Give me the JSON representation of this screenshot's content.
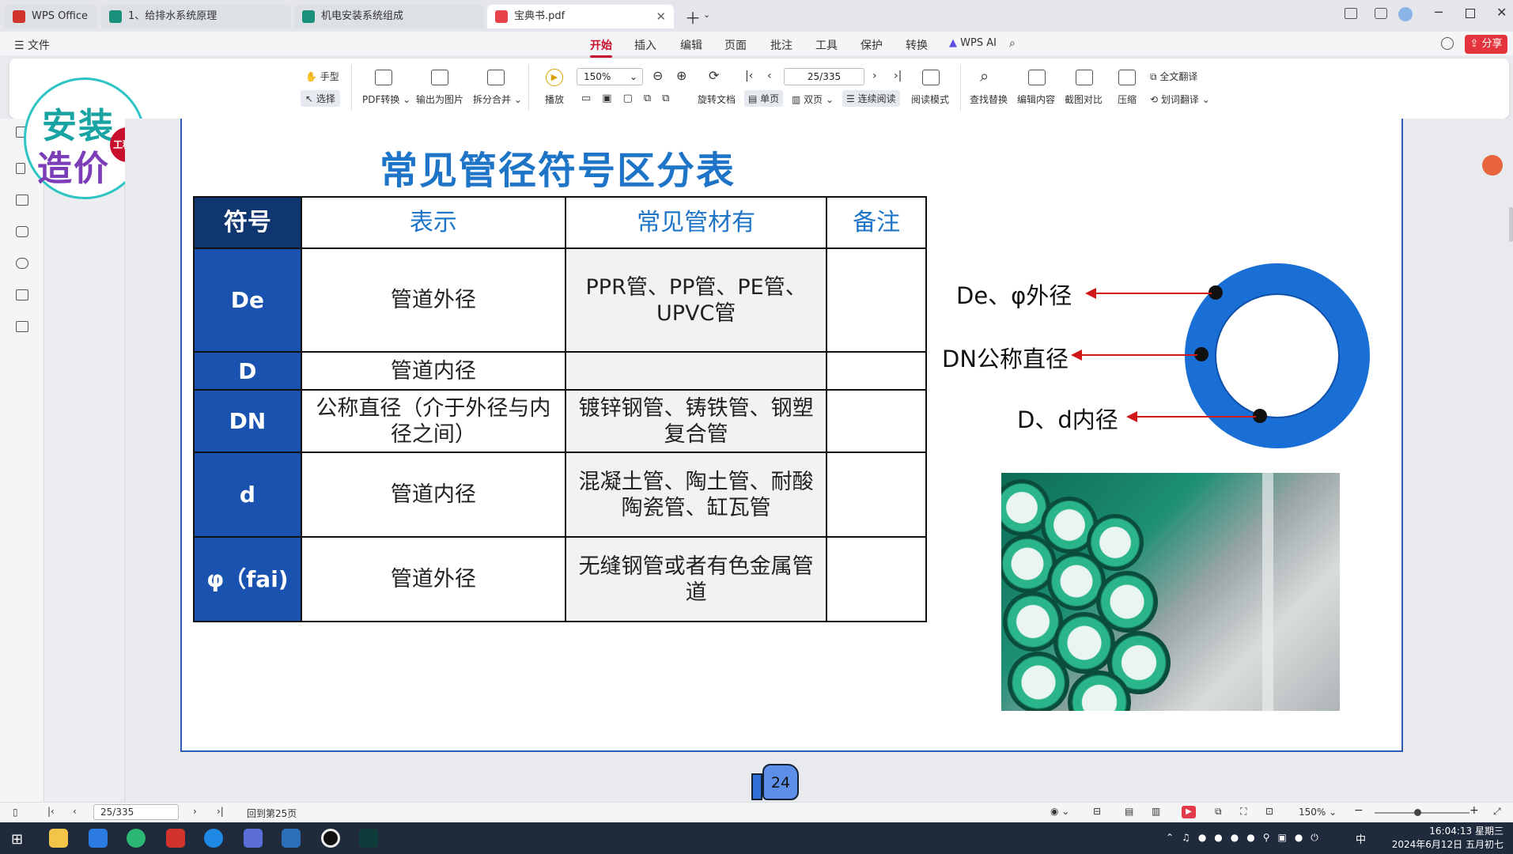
{
  "tabs": [
    {
      "label": "WPS Office",
      "icon": "wps-logo-icon"
    },
    {
      "label": "1、给排水系统原理",
      "icon": "document-icon"
    },
    {
      "label": "机电安装系统组成",
      "icon": "document-icon"
    },
    {
      "label": "宝典书.pdf",
      "icon": "pdf-icon"
    }
  ],
  "menubar": {
    "file": "文件",
    "items": [
      "开始",
      "插入",
      "编辑",
      "页面",
      "批注",
      "工具",
      "保护",
      "转换"
    ],
    "wps_ai": "WPS AI",
    "share": "分享"
  },
  "ribbon": {
    "hand": "手型",
    "select": "选择",
    "pdf_convert": "PDF转换",
    "export_image": "输出为图片",
    "split_merge": "拆分合并",
    "play": "播放",
    "zoom": "150%",
    "page": "25/335",
    "rotate": "旋转文档",
    "single": "单页",
    "double": "双页",
    "continuous": "连续阅读",
    "read_mode": "阅读模式",
    "find_replace": "查找替换",
    "edit_content": "编辑内容",
    "screenshot_compare": "截图对比",
    "compress": "压缩",
    "full_translate": "全文翻译",
    "word_translate": "划词翻译"
  },
  "logo": {
    "line1": "安装",
    "line2": "造价",
    "badge": "工程技"
  },
  "slide": {
    "title": "常见管径符号区分表",
    "headers": [
      "符号",
      "表示",
      "常见管材有",
      "备注"
    ],
    "rows": [
      {
        "symbol": "De",
        "meaning": "管道外径",
        "materials": "PPR管、PP管、PE管、UPVC管",
        "note": ""
      },
      {
        "symbol": "D",
        "meaning": "管道内径",
        "materials": "",
        "note": ""
      },
      {
        "symbol": "DN",
        "meaning": "公称直径（介于外径与内径之间）",
        "materials": "镀锌钢管、铸铁管、钢塑复合管",
        "note": ""
      },
      {
        "symbol": "d",
        "meaning": "管道内径",
        "materials": "混凝土管、陶土管、耐酸陶瓷管、缸瓦管",
        "note": ""
      },
      {
        "symbol": "φ（fai)",
        "meaning": "管道外径",
        "materials": "无缝钢管或者有色金属管道",
        "note": ""
      }
    ],
    "diagram_labels": [
      "De、φ外径",
      "DN公称直径",
      "D、d内径"
    ],
    "page_badge": "24",
    "colors": {
      "title": "#1e74c7",
      "symbol_bg": "#1a52b0",
      "ring": "#1a6fd6",
      "arrow": "#d01818"
    }
  },
  "statusbar": {
    "page": "25/335",
    "back": "回到第25页",
    "zoom": "150%"
  },
  "taskbar": {
    "time": "16:04:13 星期三",
    "date": "2024年6月12日 五月初七",
    "ime": "中"
  }
}
